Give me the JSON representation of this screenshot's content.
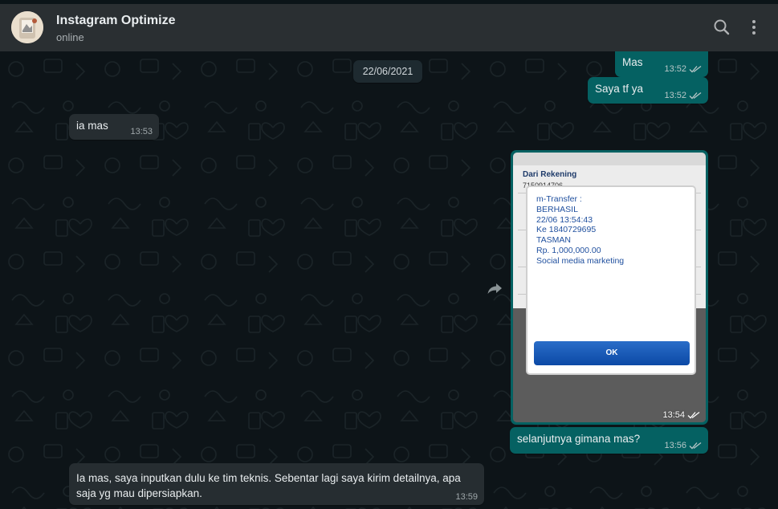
{
  "header": {
    "contact_name": "Instagram Optimize",
    "status": "online",
    "search_icon": "search-icon",
    "menu_icon": "kebab-menu-icon"
  },
  "chat": {
    "date_chip": "22/06/2021",
    "messages": [
      {
        "direction": "out",
        "text": "Mas",
        "time": "13:52",
        "status": "read"
      },
      {
        "direction": "out",
        "text": "Saya tf ya",
        "time": "13:52",
        "status": "read"
      },
      {
        "direction": "in",
        "text": "ia mas",
        "time": "13:53"
      },
      {
        "direction": "out",
        "type": "image",
        "time": "13:54",
        "status": "read",
        "image": {
          "form_label": "Dari Rekening",
          "form_account": "7150914706",
          "dialog_lines": [
            "m-Transfer :",
            "BERHASIL",
            "22/06 13:54:43",
            "Ke 1840729695",
            "TASMAN",
            "Rp. 1,000,000.00",
            "Social media marketing"
          ],
          "ok_label": "OK"
        }
      },
      {
        "direction": "out",
        "text": "selanjutnya gimana mas?",
        "time": "13:56",
        "status": "read"
      },
      {
        "direction": "in",
        "text_lines": [
          "Ia mas, saya inputkan dulu ke tim teknis. Sebentar lagi saya kirim detailnya, apa",
          "saja yg mau dipersiapkan."
        ],
        "time": "13:59"
      }
    ]
  },
  "colors": {
    "header_bg": "#2a2f32",
    "chat_bg": "#0d1418",
    "outgoing_bubble": "#056162",
    "incoming_bubble": "#262d31",
    "read_tick": "#b8c7c8"
  }
}
